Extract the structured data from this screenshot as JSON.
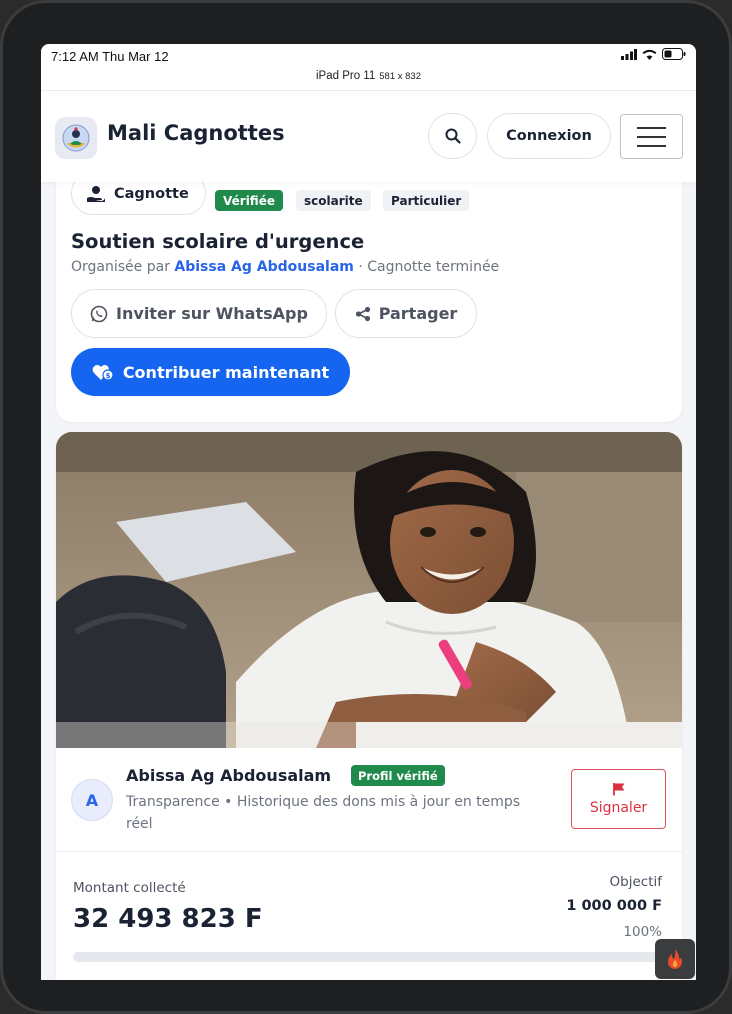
{
  "status_bar": {
    "time": "7:12 AM Thu Mar 12",
    "device_name": "iPad Pro 11",
    "device_dims": "581 x 832"
  },
  "header": {
    "app_title": "Mali Cagnottes",
    "login_label": "Connexion"
  },
  "campaign": {
    "type_label": "Cagnotte",
    "tags": [
      "Vérifiée",
      "scolarite",
      "Particulier"
    ],
    "title": "Soutien scolaire d'urgence",
    "organised_prefix": "Organisée par",
    "organiser": "Abissa Ag Abdousalam",
    "status": "· Cagnotte terminée",
    "whatsapp_label": "Inviter sur WhatsApp",
    "share_label": "Partager",
    "contribute_label": "Contribuer maintenant"
  },
  "owner": {
    "avatar_initial": "A",
    "name": "Abissa Ag Abdousalam",
    "badge": "Profil vérifié",
    "description": "Transparence • Historique des dons mis à jour en temps réel",
    "report_label": "Signaler"
  },
  "stats": {
    "collected_label": "Montant collecté",
    "collected_value": "32 493 823 F",
    "goal_label": "Objectif",
    "goal_value": "1 000 000 F",
    "percent": "100%",
    "progress_fraction": 1.0
  },
  "colors": {
    "primary": "#1565f0",
    "verified": "#1f8a4c",
    "link": "#2a64e8",
    "danger": "#d9323f"
  }
}
